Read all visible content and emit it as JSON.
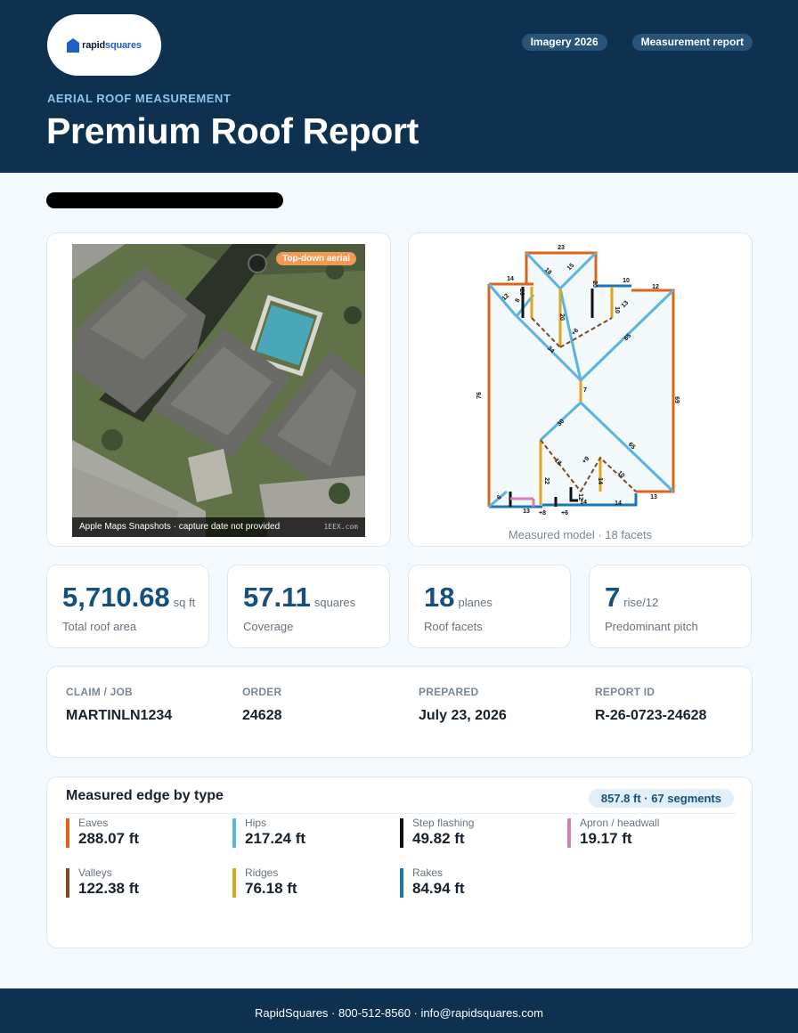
{
  "header": {
    "logo_text_a": "rapid",
    "logo_text_b": "squares",
    "chips": [
      "Imagery 2026",
      "Measurement report"
    ],
    "eyebrow": "AERIAL ROOF MEASUREMENT",
    "title": "Premium Roof Report"
  },
  "photo": {
    "badge": "Top-down aerial",
    "caption": "Apple Maps Snapshots · capture date not provided",
    "watermark": "1EEX.com"
  },
  "model": {
    "caption": "Measured model · 18 facets",
    "labels": [
      "23",
      "14",
      "10",
      "12",
      "12",
      "8",
      "20",
      "18",
      "15",
      "20",
      "10",
      "13",
      "20",
      "+6",
      "65",
      "34",
      "76",
      "69",
      "7",
      "30",
      "65",
      "22",
      "18",
      "+9",
      "14",
      "10",
      "6",
      "13",
      "+8",
      "+6",
      "14",
      "14",
      "13",
      "12"
    ]
  },
  "stats": [
    {
      "value": "5,710.68",
      "unit": "sq ft",
      "label": "Total roof area"
    },
    {
      "value": "57.11",
      "unit": "squares",
      "label": "Coverage"
    },
    {
      "value": "18",
      "unit": "planes",
      "label": "Roof facets"
    },
    {
      "value": "7",
      "unit": "rise/12",
      "label": "Predominant pitch"
    }
  ],
  "info": [
    {
      "label": "CLAIM / JOB",
      "value": "MARTINLN1234"
    },
    {
      "label": "ORDER",
      "value": "24628"
    },
    {
      "label": "PREPARED",
      "value": "July 23, 2026"
    },
    {
      "label": "REPORT ID",
      "value": "R-26-0723-24628"
    }
  ],
  "edges": {
    "title": "Measured edge by type",
    "summary": "857.8 ft · 67 segments",
    "items": [
      {
        "name": "Eaves",
        "value": "288.07 ft",
        "color": "#d9661a"
      },
      {
        "name": "Hips",
        "value": "217.24 ft",
        "color": "#5ab3e0"
      },
      {
        "name": "Step flashing",
        "value": "49.82 ft",
        "color": "#111111"
      },
      {
        "name": "Apron / headwall",
        "value": "19.17 ft",
        "color": "#d27fb2"
      },
      {
        "name": "Valleys",
        "value": "122.38 ft",
        "color": "#7a4a22"
      },
      {
        "name": "Ridges",
        "value": "76.18 ft",
        "color": "#e0a51c"
      },
      {
        "name": "Rakes",
        "value": "84.94 ft",
        "color": "#1877b8"
      }
    ]
  },
  "footer": "RapidSquares · 800-512-8560 · info@rapidsquares.com"
}
